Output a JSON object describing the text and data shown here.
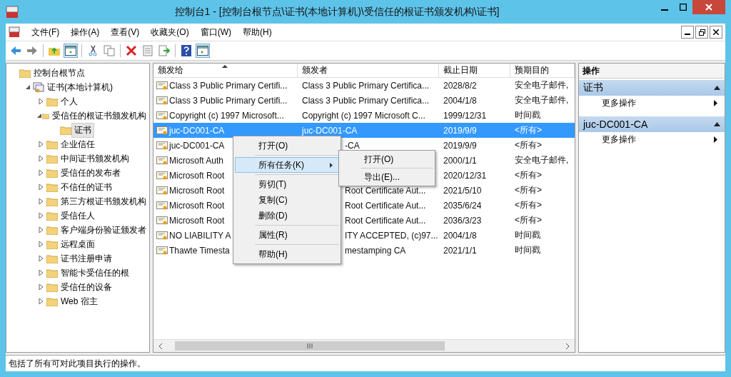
{
  "window": {
    "title": "控制台1 - [控制台根节点\\证书(本地计算机)\\受信任的根证书颁发机构\\证书]"
  },
  "menu": [
    "文件(F)",
    "操作(A)",
    "查看(V)",
    "收藏夹(O)",
    "窗口(W)",
    "帮助(H)"
  ],
  "toolbar": [
    {
      "kind": "back",
      "pressed": false
    },
    {
      "kind": "forward",
      "pressed": false
    },
    {
      "kind": "sep"
    },
    {
      "kind": "up",
      "pressed": false
    },
    {
      "kind": "tree",
      "pressed": true
    },
    {
      "kind": "sep"
    },
    {
      "kind": "cut",
      "pressed": false
    },
    {
      "kind": "copy",
      "pressed": false
    },
    {
      "kind": "sep"
    },
    {
      "kind": "delete",
      "pressed": false
    },
    {
      "kind": "props",
      "pressed": false
    },
    {
      "kind": "export",
      "pressed": false
    },
    {
      "kind": "sep"
    },
    {
      "kind": "help",
      "pressed": false
    },
    {
      "kind": "actions",
      "pressed": true
    }
  ],
  "tree": [
    {
      "label": "控制台根节点",
      "kind": "folder",
      "selected": false,
      "children": [
        {
          "label": "证书(本地计算机)",
          "kind": "store",
          "expanded": true,
          "selected": false,
          "children": [
            {
              "label": "个人",
              "kind": "folder",
              "expanded": false,
              "selected": false
            },
            {
              "label": "受信任的根证书颁发机构",
              "kind": "folder",
              "expanded": true,
              "selected": false,
              "children": [
                {
                  "label": "证书",
                  "kind": "folder",
                  "selected": true
                }
              ]
            },
            {
              "label": "企业信任",
              "kind": "folder",
              "expanded": false,
              "selected": false
            },
            {
              "label": "中间证书颁发机构",
              "kind": "folder",
              "expanded": false,
              "selected": false
            },
            {
              "label": "受信任的发布者",
              "kind": "folder",
              "expanded": false,
              "selected": false
            },
            {
              "label": "不信任的证书",
              "kind": "folder",
              "expanded": false,
              "selected": false
            },
            {
              "label": "第三方根证书颁发机构",
              "kind": "folder",
              "expanded": false,
              "selected": false
            },
            {
              "label": "受信任人",
              "kind": "folder",
              "expanded": false,
              "selected": false
            },
            {
              "label": "客户端身份验证颁发者",
              "kind": "folder",
              "expanded": false,
              "selected": false
            },
            {
              "label": "远程桌面",
              "kind": "folder",
              "expanded": false,
              "selected": false
            },
            {
              "label": "证书注册申请",
              "kind": "folder",
              "expanded": false,
              "selected": false
            },
            {
              "label": "智能卡受信任的根",
              "kind": "folder",
              "expanded": false,
              "selected": false
            },
            {
              "label": "受信任的设备",
              "kind": "folder",
              "expanded": false,
              "selected": false
            },
            {
              "label": "Web 宿主",
              "kind": "folder",
              "expanded": false,
              "selected": false
            }
          ]
        }
      ]
    }
  ],
  "table": {
    "columns": [
      "颁发给",
      "颁发者",
      "截止日期",
      "预期目的"
    ],
    "rows": [
      {
        "issued_to": "Class 3 Public Primary Certifi...",
        "issuer": "Class 3 Public Primary Certifica...",
        "expires": "2028/8/2",
        "purpose": "安全电子邮件,",
        "selected": false
      },
      {
        "issued_to": "Class 3 Public Primary Certifi...",
        "issuer": "Class 3 Public Primary Certifica...",
        "expires": "2004/1/8",
        "purpose": "安全电子邮件,",
        "selected": false
      },
      {
        "issued_to": "Copyright (c) 1997 Microsoft...",
        "issuer": "Copyright (c) 1997 Microsoft C...",
        "expires": "1999/12/31",
        "purpose": "时间戳",
        "selected": false
      },
      {
        "issued_to": "juc-DC001-CA",
        "issuer": "juc-DC001-CA",
        "expires": "2019/9/9",
        "purpose": "<所有>",
        "selected": true
      },
      {
        "issued_to": "juc-DC001-CA",
        "issuer": "-CA",
        "issuer_clipped": true,
        "expires": "2019/9/9",
        "purpose": "<所有>",
        "selected": false
      },
      {
        "issued_to": "Microsoft Auth",
        "expires": "2000/1/1",
        "purpose": "安全电子邮件,",
        "selected": false
      },
      {
        "issued_to": "Microsoft Root",
        "expires": "2020/12/31",
        "purpose": "<所有>",
        "selected": false
      },
      {
        "issued_to": "Microsoft Root",
        "issuer": "Root Certificate Aut...",
        "issuer_clipped": true,
        "expires": "2021/5/10",
        "purpose": "<所有>",
        "selected": false
      },
      {
        "issued_to": "Microsoft Root",
        "issuer": "Root Certificate Aut...",
        "issuer_clipped": true,
        "expires": "2035/6/24",
        "purpose": "<所有>",
        "selected": false
      },
      {
        "issued_to": "Microsoft Root",
        "issuer": "Root Certificate Aut...",
        "issuer_clipped": true,
        "expires": "2036/3/23",
        "purpose": "<所有>",
        "selected": false
      },
      {
        "issued_to": "NO LIABILITY A",
        "issuer": "ITY ACCEPTED, (c)97...",
        "issuer_clipped": true,
        "expires": "2004/1/8",
        "purpose": "时间戳",
        "selected": false
      },
      {
        "issued_to": "Thawte Timesta",
        "issuer": "mestamping CA",
        "issuer_clipped": true,
        "expires": "2021/1/1",
        "purpose": "时间戳",
        "selected": false
      }
    ]
  },
  "context_menu": [
    {
      "kind": "item",
      "label": "打开(O)",
      "selected": false
    },
    {
      "kind": "sep"
    },
    {
      "kind": "submenu",
      "label": "所有任务(K)",
      "selected": true
    },
    {
      "kind": "sep"
    },
    {
      "kind": "item",
      "label": "剪切(T)",
      "selected": false
    },
    {
      "kind": "item",
      "label": "复制(C)",
      "selected": false
    },
    {
      "kind": "item",
      "label": "删除(D)",
      "selected": false
    },
    {
      "kind": "sep"
    },
    {
      "kind": "item",
      "label": "属性(R)",
      "selected": false
    },
    {
      "kind": "sep"
    },
    {
      "kind": "item",
      "label": "帮助(H)",
      "selected": false
    }
  ],
  "submenu": [
    {
      "kind": "item",
      "label": "打开(O)"
    },
    {
      "kind": "sep"
    },
    {
      "kind": "item",
      "label": "导出(E)..."
    }
  ],
  "actions": {
    "title": "操作",
    "sections": [
      {
        "title": "证书",
        "expanded": true,
        "items": [
          "更多操作"
        ]
      },
      {
        "title": "juc-DC001-CA",
        "expanded": true,
        "items": [
          "更多操作"
        ]
      }
    ]
  },
  "status_bar": "包括了所有可对此项目执行的操作。"
}
